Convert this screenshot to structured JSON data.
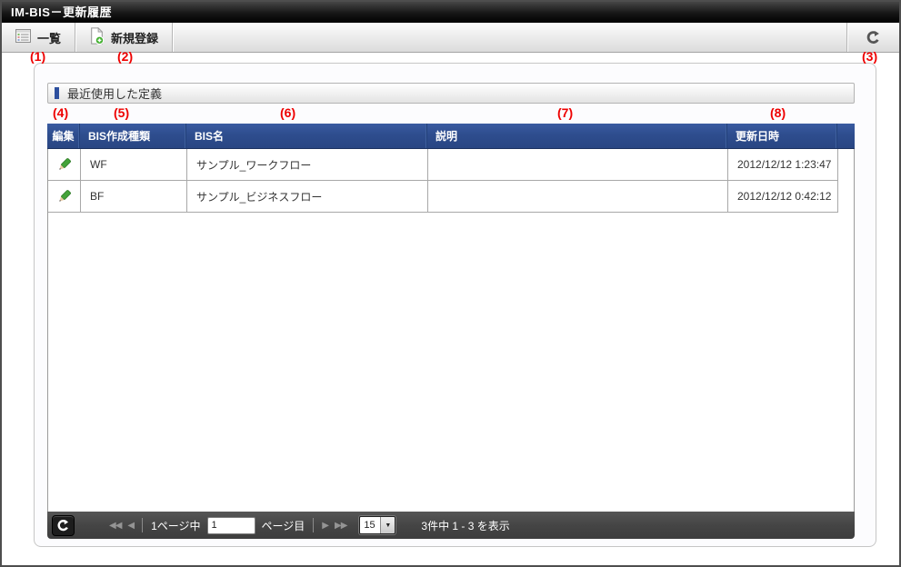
{
  "window": {
    "title": "IM-BIS－更新履歴"
  },
  "toolbar": {
    "list_label": "一覧",
    "new_label": "新規登録"
  },
  "annotations": {
    "a1": "(1)",
    "a2": "(2)",
    "a3": "(3)",
    "a4": "(4)",
    "a5": "(5)",
    "a6": "(6)",
    "a7": "(7)",
    "a8": "(8)"
  },
  "section": {
    "title": "最近使用した定義"
  },
  "table": {
    "headers": {
      "edit": "編集",
      "type": "BIS作成種類",
      "name": "BIS名",
      "description": "説明",
      "updated": "更新日時"
    },
    "rows": [
      {
        "type": "WF",
        "name": "サンプル_ワークフロー",
        "description": "",
        "updated": "2012/12/12 1:23:47"
      },
      {
        "type": "BF",
        "name": "サンプル_ビジネスフロー",
        "description": "",
        "updated": "2012/12/12 0:42:12"
      }
    ]
  },
  "pagination": {
    "page_prefix": "1ページ中",
    "page_input_value": "1",
    "page_suffix": "ページ目",
    "page_size": "15",
    "summary": "3件中 1 - 3 を表示"
  },
  "colors": {
    "header_blue": "#2e4d8e",
    "accent_blue": "#2d4f9e",
    "annotation_red": "#ee0000",
    "pencil_green": "#44a339",
    "plus_green": "#3fae2c"
  }
}
